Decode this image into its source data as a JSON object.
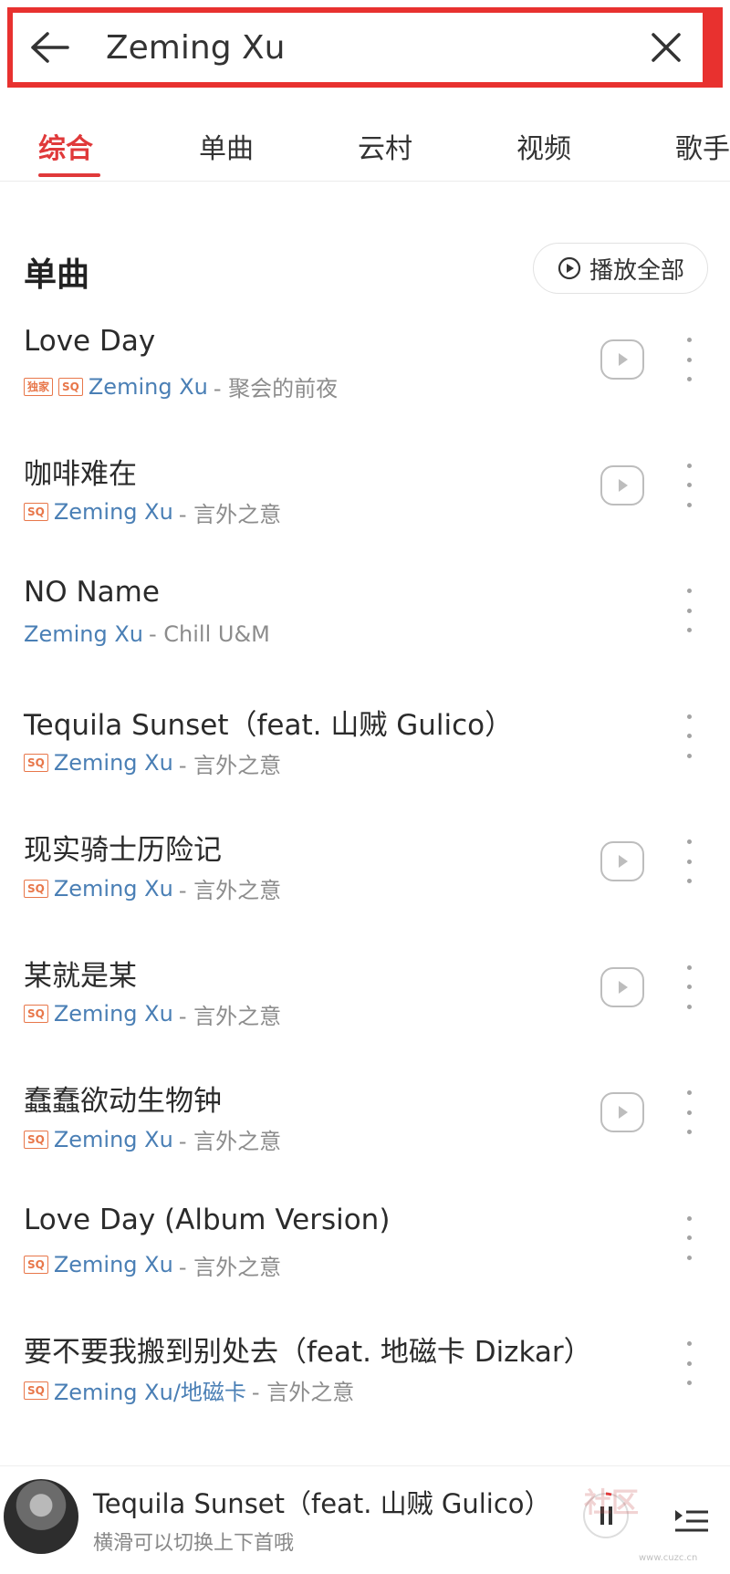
{
  "search": {
    "query": "Zeming Xu"
  },
  "tabs": [
    {
      "label": "综合",
      "active": true
    },
    {
      "label": "单曲"
    },
    {
      "label": "云村"
    },
    {
      "label": "视频"
    },
    {
      "label": "歌手"
    }
  ],
  "section": {
    "title": "单曲",
    "play_all_label": "播放全部"
  },
  "songs": [
    {
      "title": "Love Day",
      "badges": [
        "独家",
        "SQ"
      ],
      "artist": "Zeming Xu",
      "album": " - 聚会的前夜",
      "has_play": true
    },
    {
      "title": "咖啡难在",
      "badges": [
        "SQ"
      ],
      "artist": "Zeming Xu",
      "album": " - 言外之意",
      "has_play": true
    },
    {
      "title": "NO Name",
      "badges": [],
      "artist": "Zeming Xu",
      "album": " - Chill U&M",
      "has_play": false
    },
    {
      "title": "Tequila Sunset（feat. 山贼 Gulico）",
      "badges": [
        "SQ"
      ],
      "artist": "Zeming Xu",
      "album": " - 言外之意",
      "has_play": false
    },
    {
      "title": "现实骑士历险记",
      "badges": [
        "SQ"
      ],
      "artist": "Zeming Xu",
      "album": " - 言外之意",
      "has_play": true
    },
    {
      "title": "某就是某",
      "badges": [
        "SQ"
      ],
      "artist": "Zeming Xu",
      "album": " - 言外之意",
      "has_play": true
    },
    {
      "title": "蠢蠢欲动生物钟",
      "badges": [
        "SQ"
      ],
      "artist": "Zeming Xu",
      "album": " - 言外之意",
      "has_play": true
    },
    {
      "title": "Love Day (Album Version)",
      "badges": [
        "SQ"
      ],
      "artist": "Zeming Xu",
      "album": " - 言外之意",
      "has_play": false
    },
    {
      "title": "要不要我搬到别处去（feat. 地磁卡 Dizkar）",
      "badges": [
        "SQ"
      ],
      "artist": "Zeming Xu/地磁卡",
      "album": " - 言外之意",
      "has_play": false
    }
  ],
  "player": {
    "title": "Tequila Sunset（feat. 山贼 Gulico）",
    "hint": "横滑可以切换上下首哦"
  },
  "watermark": {
    "text": "社区",
    "url": "www.cuzc.cn"
  },
  "colors": {
    "accent": "#e0393a",
    "artist": "#4a7fb5",
    "badge": "#e8774a"
  }
}
